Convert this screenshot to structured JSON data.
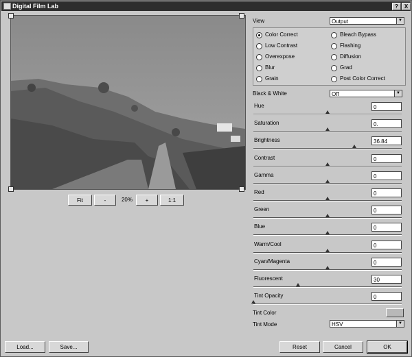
{
  "window": {
    "title": "Digital Film Lab",
    "help_label": "?",
    "close_label": "X"
  },
  "zoom": {
    "fit_label": "Fit",
    "minus_label": "-",
    "level": "20%",
    "plus_label": "+",
    "actual_label": "1:1"
  },
  "view": {
    "label": "View",
    "value": "Output"
  },
  "modes": [
    {
      "label": "Color Correct",
      "selected": true
    },
    {
      "label": "Bleach Bypass",
      "selected": false
    },
    {
      "label": "Low Contrast",
      "selected": false
    },
    {
      "label": "Flashing",
      "selected": false
    },
    {
      "label": "Overexpose",
      "selected": false
    },
    {
      "label": "Diffusion",
      "selected": false
    },
    {
      "label": "Blur",
      "selected": false
    },
    {
      "label": "Grad",
      "selected": false
    },
    {
      "label": "Grain",
      "selected": false
    },
    {
      "label": "Post Color Correct",
      "selected": false
    }
  ],
  "bw": {
    "label": "Black & White",
    "value": "Off"
  },
  "sliders": [
    {
      "label": "Hue",
      "value": "0",
      "fraction": 0.5
    },
    {
      "label": "Saturation",
      "value": "0.",
      "fraction": 0.5
    },
    {
      "label": "Brightness",
      "value": "36.84",
      "fraction": 0.68
    },
    {
      "label": "Contrast",
      "value": "0",
      "fraction": 0.5
    },
    {
      "label": "Gamma",
      "value": "0",
      "fraction": 0.5
    },
    {
      "label": "Red",
      "value": "0",
      "fraction": 0.5
    },
    {
      "label": "Green",
      "value": "0",
      "fraction": 0.5
    },
    {
      "label": "Blue",
      "value": "0",
      "fraction": 0.5
    },
    {
      "label": "Warm/Cool",
      "value": "0",
      "fraction": 0.5
    },
    {
      "label": "Cyan/Magenta",
      "value": "0",
      "fraction": 0.5
    },
    {
      "label": "Fluorescent",
      "value": "30",
      "fraction": 0.3
    },
    {
      "label": "Tint Opacity",
      "value": "0",
      "fraction": 0.0
    }
  ],
  "tint_color": {
    "label": "Tint Color",
    "swatch": "#b8b8b8"
  },
  "tint_mode": {
    "label": "Tint Mode",
    "value": "HSV"
  },
  "buttons": {
    "load": "Load...",
    "save": "Save...",
    "reset": "Reset",
    "cancel": "Cancel",
    "ok": "OK"
  }
}
